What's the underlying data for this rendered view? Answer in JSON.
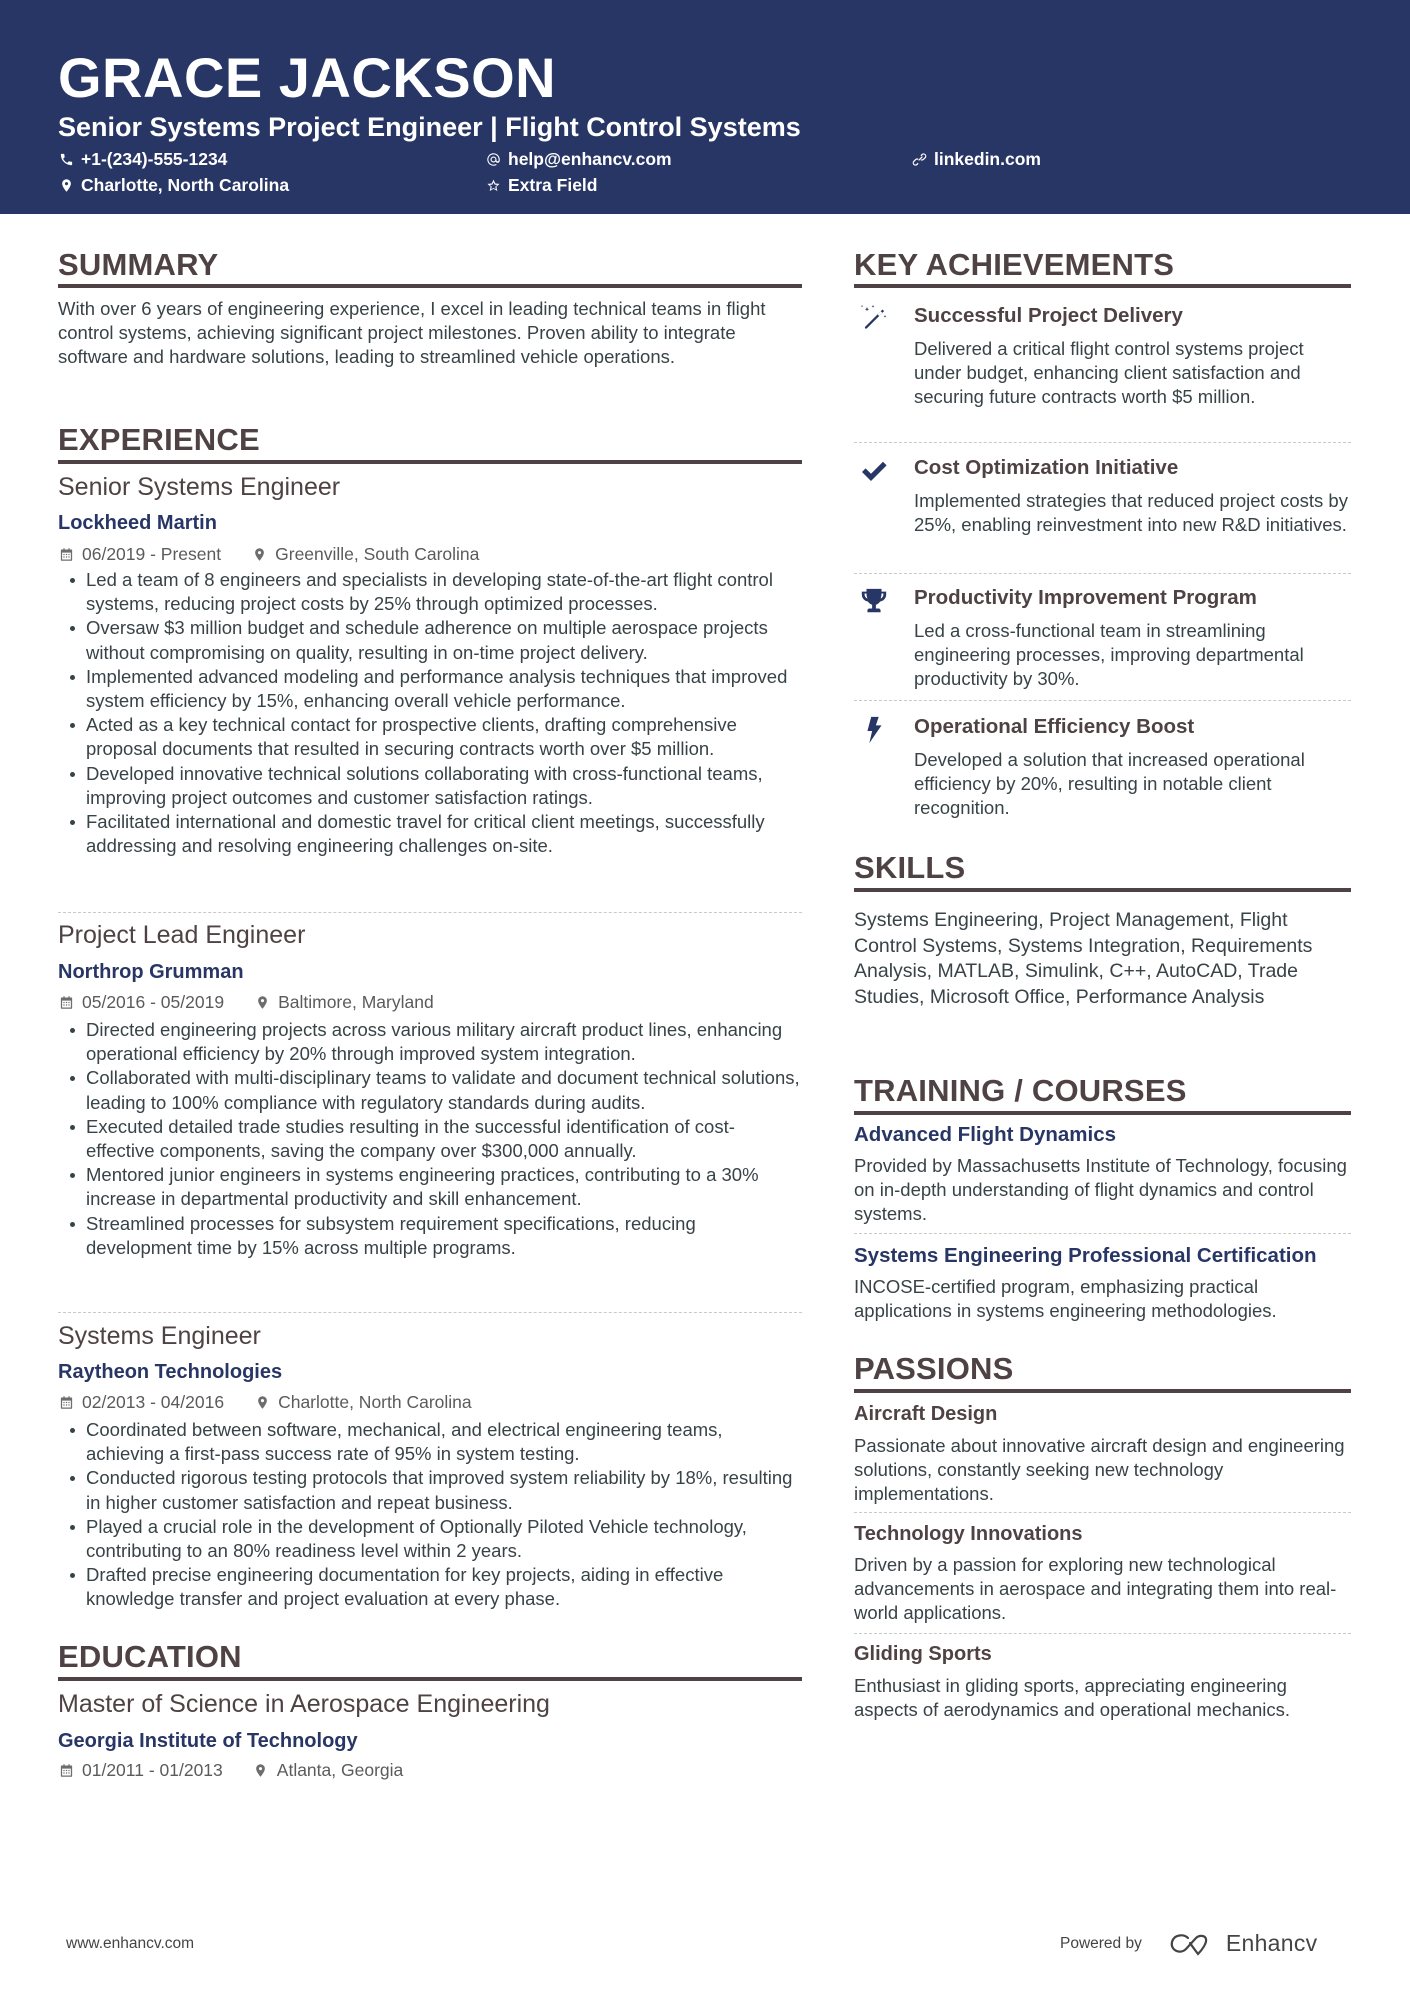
{
  "header": {
    "name": "GRACE JACKSON",
    "headline": "Senior Systems Project Engineer | Flight Control Systems",
    "contacts": [
      {
        "icon": "phone-icon",
        "text": "+1-(234)-555-1234"
      },
      {
        "icon": "at-icon",
        "text": "help@enhancv.com"
      },
      {
        "icon": "link-icon",
        "text": "linkedin.com"
      },
      {
        "icon": "location-pin-icon",
        "text": "Charlotte, North Carolina"
      },
      {
        "icon": "star-icon",
        "text": "Extra Field"
      }
    ]
  },
  "summary": {
    "title": "SUMMARY",
    "text": "With over 6 years of engineering experience, I excel in leading technical teams in flight control systems, achieving significant project milestones. Proven ability to integrate software and hardware solutions, leading to streamlined vehicle operations."
  },
  "experience": {
    "title": "EXPERIENCE",
    "jobs": [
      {
        "title": "Senior Systems Engineer",
        "company": "Lockheed Martin",
        "dates": "06/2019 - Present",
        "location": "Greenville, South Carolina",
        "bullets": [
          "Led a team of 8 engineers and specialists in developing state-of-the-art flight control systems, reducing project costs by 25% through optimized processes.",
          "Oversaw $3 million budget and schedule adherence on multiple aerospace projects without compromising on quality, resulting in on-time project delivery.",
          "Implemented advanced modeling and performance analysis techniques that improved system efficiency by 15%, enhancing overall vehicle performance.",
          "Acted as a key technical contact for prospective clients, drafting comprehensive proposal documents that resulted in securing contracts worth over $5 million.",
          "Developed innovative technical solutions collaborating with cross-functional teams, improving project outcomes and customer satisfaction ratings.",
          "Facilitated international and domestic travel for critical client meetings, successfully addressing and resolving engineering challenges on-site."
        ]
      },
      {
        "title": "Project Lead Engineer",
        "company": "Northrop Grumman",
        "dates": "05/2016 - 05/2019",
        "location": "Baltimore, Maryland",
        "bullets": [
          "Directed engineering projects across various military aircraft product lines, enhancing operational efficiency by 20% through improved system integration.",
          "Collaborated with multi-disciplinary teams to validate and document technical solutions, leading to 100% compliance with regulatory standards during audits.",
          "Executed detailed trade studies resulting in the successful identification of cost-effective components, saving the company over $300,000 annually.",
          "Mentored junior engineers in systems engineering practices, contributing to a 30% increase in departmental productivity and skill enhancement.",
          "Streamlined processes for subsystem requirement specifications, reducing development time by 15% across multiple programs."
        ]
      },
      {
        "title": "Systems Engineer",
        "company": "Raytheon Technologies",
        "dates": "02/2013 - 04/2016",
        "location": "Charlotte, North Carolina",
        "bullets": [
          "Coordinated between software, mechanical, and electrical engineering teams, achieving a first-pass success rate of 95% in system testing.",
          "Conducted rigorous testing protocols that improved system reliability by 18%, resulting in higher customer satisfaction and repeat business.",
          "Played a crucial role in the development of Optionally Piloted Vehicle technology, contributing to an 80% readiness level within 2 years.",
          "Drafted precise engineering documentation for key projects, aiding in effective knowledge transfer and project evaluation at every phase."
        ]
      }
    ]
  },
  "education": {
    "title": "EDUCATION",
    "items": [
      {
        "degree": "Master of Science in Aerospace Engineering",
        "school": "Georgia Institute of Technology",
        "dates": "01/2011 - 01/2013",
        "location": "Atlanta, Georgia"
      }
    ]
  },
  "achievements": {
    "title": "KEY ACHIEVEMENTS",
    "items": [
      {
        "icon": "magic-wand-icon",
        "title": "Successful Project Delivery",
        "text": "Delivered a critical flight control systems project under budget, enhancing client satisfaction and securing future contracts worth $5 million."
      },
      {
        "icon": "checkmark-icon",
        "title": "Cost Optimization Initiative",
        "text": "Implemented strategies that reduced project costs by 25%, enabling reinvestment into new R&D initiatives."
      },
      {
        "icon": "trophy-icon",
        "title": "Productivity Improvement Program",
        "text": "Led a cross-functional team in streamlining engineering processes, improving departmental productivity by 30%."
      },
      {
        "icon": "lightning-bolt-icon",
        "title": "Operational Efficiency Boost",
        "text": "Developed a solution that increased operational efficiency by 20%, resulting in notable client recognition."
      }
    ]
  },
  "skills": {
    "title": "SKILLS",
    "text": "Systems Engineering, Project Management, Flight Control Systems, Systems Integration, Requirements Analysis, MATLAB, Simulink, C++, AutoCAD, Trade Studies, Microsoft Office, Performance Analysis"
  },
  "training": {
    "title": "TRAINING / COURSES",
    "items": [
      {
        "title": "Advanced Flight Dynamics",
        "text": "Provided by Massachusetts Institute of Technology, focusing on in-depth understanding of flight dynamics and control systems."
      },
      {
        "title": "Systems Engineering Professional Certification",
        "text": "INCOSE-certified program, emphasizing practical applications in systems engineering methodologies."
      }
    ]
  },
  "passions": {
    "title": "PASSIONS",
    "items": [
      {
        "title": "Aircraft Design",
        "text": "Passionate about innovative aircraft design and engineering solutions, constantly seeking new technology implementations."
      },
      {
        "title": "Technology Innovations",
        "text": "Driven by a passion for exploring new technological advancements in aerospace and integrating them into real-world applications."
      },
      {
        "title": "Gliding Sports",
        "text": "Enthusiast in gliding sports, appreciating engineering aspects of aerodynamics and operational mechanics."
      }
    ]
  },
  "footer": {
    "website": "www.enhancv.com",
    "powered_by": "Powered by",
    "brand": "Enhancv"
  },
  "colors": {
    "header_bg": "#283665",
    "accent": "#283665",
    "heading": "#4f4244",
    "body_text": "#384347"
  }
}
